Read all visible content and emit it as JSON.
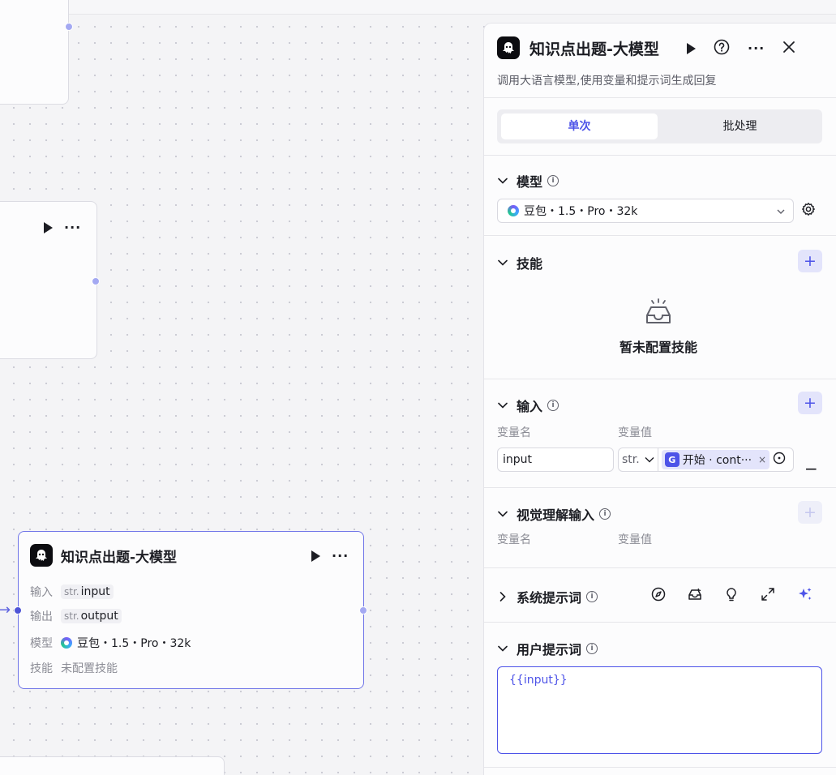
{
  "canvas": {
    "node": {
      "title": "知识点出题-大模型",
      "input_label": "输入",
      "input_type": "str.",
      "input_name": "input",
      "output_label": "输出",
      "output_type": "str.",
      "output_name": "output",
      "model_label": "模型",
      "model_value": "豆包・1.5・Pro・32k",
      "skill_label": "技能",
      "skill_value": "未配置技能"
    }
  },
  "panel": {
    "title": "知识点出题-大模型",
    "description": "调用大语言模型,使用变量和提示词生成回复",
    "tabs": [
      {
        "label": "单次",
        "active": true
      },
      {
        "label": "批处理",
        "active": false
      }
    ],
    "model": {
      "heading": "模型",
      "selected": "豆包・1.5・Pro・32k"
    },
    "skills": {
      "heading": "技能",
      "empty_text": "暂未配置技能"
    },
    "inputs": {
      "heading": "输入",
      "col_name": "变量名",
      "col_value": "变量值",
      "rows": [
        {
          "name": "input",
          "type": "str.",
          "ref_text": "开始 · cont···"
        }
      ]
    },
    "vision": {
      "heading": "视觉理解输入",
      "col_name": "变量名",
      "col_value": "变量值"
    },
    "system_prompt": {
      "heading": "系统提示词"
    },
    "user_prompt": {
      "heading": "用户提示词",
      "value": "{{input}}"
    }
  },
  "colors": {
    "accent": "#4d53e8",
    "node_border": "#6f74e8",
    "canvas_bg": "#f4f4f6"
  },
  "icons": [
    "robot-logo-icon",
    "play-icon",
    "help-icon",
    "more-icon",
    "close-icon",
    "chevron-down-icon",
    "chevron-right-icon",
    "info-icon",
    "settings-icon",
    "plus-icon",
    "empty-box-icon",
    "minus-icon",
    "compass-icon",
    "library-icon",
    "bulb-icon",
    "expand-icon",
    "sparkle-icon"
  ]
}
